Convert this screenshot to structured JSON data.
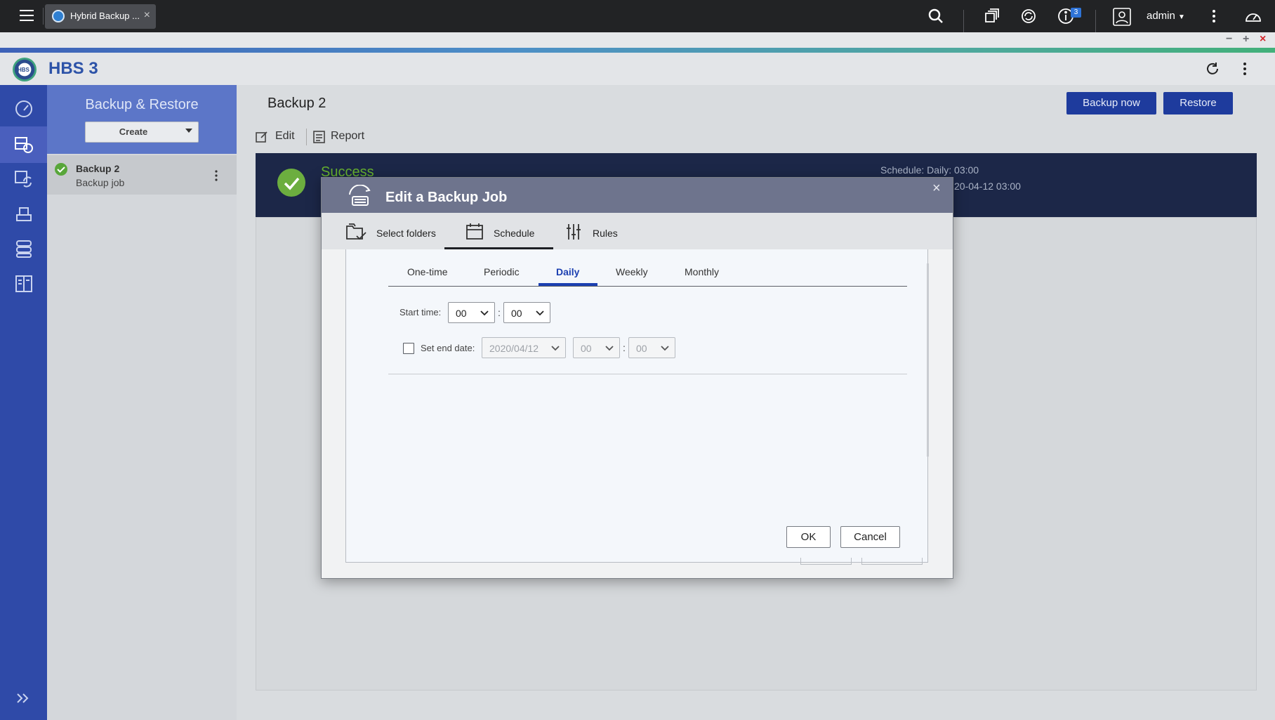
{
  "topbar": {
    "tab_title": "Hybrid Backup ...",
    "notification_count": "3",
    "user": "admin"
  },
  "app": {
    "title": "HBS 3",
    "logo_text": "HBS"
  },
  "sidebar": {
    "section_title": "Backup & Restore",
    "create_label": "Create",
    "jobs": [
      {
        "name": "Backup 2",
        "type": "Backup job"
      }
    ]
  },
  "main": {
    "title": "Backup 2",
    "backup_now_label": "Backup now",
    "restore_label": "Restore",
    "edit_label": "Edit",
    "report_label": "Report",
    "status": "Success",
    "schedule_text": "Schedule: Daily: 03:00",
    "last_run_text": "20-04-12 03:00"
  },
  "dialog": {
    "title": "Edit a Backup Job",
    "tabs": [
      "Select folders",
      "Schedule",
      "Rules"
    ],
    "active_tab": "Schedule",
    "schedule_tabs": [
      "One-time",
      "Periodic",
      "Daily",
      "Weekly",
      "Monthly"
    ],
    "active_schedule_tab": "Daily",
    "start_time_label": "Start time:",
    "start_hour": "00",
    "start_minute": "00",
    "end_date_label": "Set end date:",
    "end_date": "2020/04/12",
    "end_hour": "00",
    "end_minute": "00",
    "time_separator": ":",
    "ok_label": "OK",
    "cancel_label": "Cancel"
  },
  "colors": {
    "rail": "#2f4aa8",
    "primary_button": "#1e3b9d",
    "success": "#66b12f",
    "dialog_header": "#6e748d"
  }
}
